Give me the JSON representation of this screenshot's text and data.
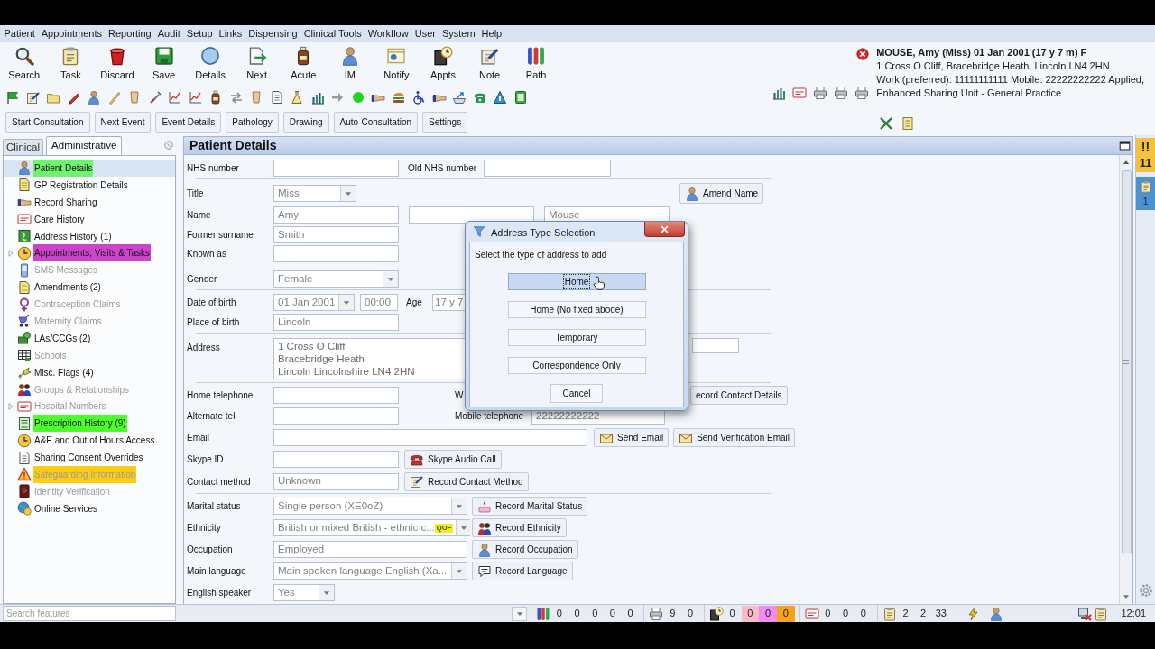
{
  "menu": [
    "Patient",
    "Appointments",
    "Reporting",
    "Audit",
    "Setup",
    "Links",
    "Dispensing",
    "Clinical Tools",
    "Workflow",
    "User",
    "System",
    "Help"
  ],
  "toolbar": [
    "Search",
    "Task",
    "Discard",
    "Save",
    "Details",
    "Next",
    "Acute",
    "IM",
    "Notify",
    "Appts",
    "Note",
    "Path"
  ],
  "consultation_buttons": [
    "Start Consultation",
    "Next Event",
    "Event Details",
    "Pathology",
    "Drawing",
    "Auto-Consultation",
    "Settings"
  ],
  "patient_banner": {
    "name": "MOUSE, Amy (Miss) 01 Jan 2001 (17 y 7 m) F",
    "lines": [
      "1 Cross O Cliff, Bracebridge Heath, Lincoln LN4 2HN",
      "Work (preferred): 11111111111 Mobile: 22222222222 Applied,",
      "Enhanced Sharing Unit - General Practice"
    ]
  },
  "sidebar": {
    "tabs": [
      {
        "label": "Clinical",
        "selected": false
      },
      {
        "label": "Administrative",
        "selected": true
      }
    ],
    "items": [
      {
        "label": "Patient Details",
        "selected": true,
        "disabled": false,
        "expandable": false,
        "color": "#6ef56e"
      },
      {
        "label": "GP Registration Details",
        "selected": false,
        "disabled": false,
        "expandable": false
      },
      {
        "label": "Record Sharing",
        "selected": false,
        "disabled": false,
        "expandable": false
      },
      {
        "label": "Care History",
        "selected": false,
        "disabled": false,
        "expandable": false
      },
      {
        "label": "Address History (1)",
        "selected": false,
        "disabled": false,
        "expandable": false
      },
      {
        "label": "Appointments, Visits & Tasks",
        "selected": false,
        "disabled": false,
        "expandable": true,
        "color": "#cc44cc"
      },
      {
        "label": "SMS Messages",
        "selected": false,
        "disabled": true,
        "expandable": false
      },
      {
        "label": "Amendments (2)",
        "selected": false,
        "disabled": false,
        "expandable": false
      },
      {
        "label": "Contraception Claims",
        "selected": false,
        "disabled": true,
        "expandable": false
      },
      {
        "label": "Maternity Claims",
        "selected": false,
        "disabled": true,
        "expandable": false
      },
      {
        "label": "LAs/CCGs (2)",
        "selected": false,
        "disabled": false,
        "expandable": false
      },
      {
        "label": "Schools",
        "selected": false,
        "disabled": true,
        "expandable": false
      },
      {
        "label": "Misc. Flags (4)",
        "selected": false,
        "disabled": false,
        "expandable": false
      },
      {
        "label": "Groups & Relationships",
        "selected": false,
        "disabled": true,
        "expandable": false
      },
      {
        "label": "Hospital Numbers",
        "selected": false,
        "disabled": true,
        "expandable": true
      },
      {
        "label": "Prescription History (9)",
        "selected": false,
        "disabled": false,
        "expandable": false,
        "color": "#4cff2a"
      },
      {
        "label": "A&E and Out of Hours Access",
        "selected": false,
        "disabled": false,
        "expandable": false
      },
      {
        "label": "Sharing Consent Overrides",
        "selected": false,
        "disabled": false,
        "expandable": false
      },
      {
        "label": "Safeguarding Information",
        "selected": false,
        "disabled": true,
        "expandable": false,
        "color": "#ffcc11"
      },
      {
        "label": "Identity Verification",
        "selected": false,
        "disabled": true,
        "expandable": false
      },
      {
        "label": "Online Services",
        "selected": false,
        "disabled": false,
        "expandable": false
      }
    ]
  },
  "patient_details": {
    "title": "Patient Details",
    "rows": [
      {
        "label": "NHS number",
        "controls": [
          {
            "kind": "field"
          },
          {
            "kind": "label",
            "text": "Old NHS number"
          },
          {
            "kind": "field"
          }
        ]
      },
      {
        "label": "Title",
        "controls": [
          {
            "kind": "combo",
            "value": "Miss"
          },
          {
            "kind": "button",
            "text": "Amend Name"
          }
        ]
      },
      {
        "label": "Name",
        "controls": [
          {
            "kind": "field",
            "value": "Amy"
          },
          {
            "kind": "field"
          },
          {
            "kind": "field",
            "value": "Mouse"
          }
        ]
      },
      {
        "label": "Former surname",
        "controls": [
          {
            "kind": "field",
            "value": "Smith"
          }
        ]
      },
      {
        "label": "Known as",
        "controls": [
          {
            "kind": "field"
          }
        ]
      },
      {
        "label": "Gender",
        "controls": [
          {
            "kind": "combo",
            "value": "Female"
          }
        ]
      },
      {
        "label": "Date of birth",
        "controls": [
          {
            "kind": "combo",
            "value": "01 Jan 2001"
          },
          {
            "kind": "field",
            "value": "00:00"
          },
          {
            "kind": "label",
            "text": "Age"
          },
          {
            "kind": "field",
            "value": "17 y 7"
          }
        ]
      },
      {
        "label": "Place of birth",
        "controls": [
          {
            "kind": "field",
            "value": "Lincoln"
          }
        ]
      },
      {
        "label": "Address",
        "controls": [
          {
            "kind": "textarea",
            "lines": [
              "1 Cross O Cliff",
              "Bracebridge Heath",
              "Lincoln Lincolnshire LN4 2HN"
            ]
          },
          {
            "kind": "field"
          }
        ]
      },
      {
        "label": "Home telephone",
        "controls": [
          {
            "kind": "field"
          },
          {
            "kind": "label",
            "text": "W"
          },
          {
            "kind": "button",
            "text": "ecord Contact Details"
          }
        ]
      },
      {
        "label": "Alternate tel.",
        "controls": [
          {
            "kind": "field"
          },
          {
            "kind": "label",
            "text": "Mobile telephone"
          },
          {
            "kind": "field",
            "value": "22222222222"
          }
        ]
      },
      {
        "label": "Email",
        "controls": [
          {
            "kind": "field"
          },
          {
            "kind": "button",
            "text": "Send Email"
          },
          {
            "kind": "button",
            "text": "Send Verification Email"
          }
        ]
      },
      {
        "label": "Skype ID",
        "controls": [
          {
            "kind": "field"
          },
          {
            "kind": "button",
            "text": "Skype Audio Call"
          }
        ]
      },
      {
        "label": "Contact method",
        "controls": [
          {
            "kind": "field",
            "value": "Unknown"
          },
          {
            "kind": "button",
            "text": "Record Contact Method"
          }
        ]
      },
      {
        "label": "Marital status",
        "controls": [
          {
            "kind": "combo",
            "value": "Single person (XE0oZ)"
          },
          {
            "kind": "button",
            "text": "Record Marital Status"
          }
        ]
      },
      {
        "label": "Ethnicity",
        "controls": [
          {
            "kind": "combo",
            "value": "British or mixed British - ethnic c...",
            "badge": "QOF"
          },
          {
            "kind": "button",
            "text": "Record Ethnicity"
          }
        ]
      },
      {
        "label": "Occupation",
        "controls": [
          {
            "kind": "field",
            "value": "Employed"
          },
          {
            "kind": "button",
            "text": "Record Occupation"
          }
        ]
      },
      {
        "label": "Main language",
        "controls": [
          {
            "kind": "combo",
            "value": "Main spoken language English (Xa..."
          },
          {
            "kind": "button",
            "text": "Record Language"
          }
        ]
      },
      {
        "label": "English speaker",
        "controls": [
          {
            "kind": "combo",
            "value": "Yes"
          }
        ]
      }
    ]
  },
  "dialog": {
    "title": "Address Type Selection",
    "prompt": "Select the type of address to add",
    "options": [
      {
        "label": "Home",
        "selected": true
      },
      {
        "label": "Home (No fixed abode)",
        "selected": false
      },
      {
        "label": "Temporary",
        "selected": false
      },
      {
        "label": "Correspondence Only",
        "selected": false
      }
    ],
    "cancel": "Cancel"
  },
  "alerts": {
    "marks": "!!",
    "count": "11"
  },
  "tasks": {
    "count": "1"
  },
  "status_bar": {
    "search": {
      "placeholder": "Search features"
    },
    "groups": [
      {
        "values": [
          {
            "text": "0"
          },
          {
            "text": "0"
          },
          {
            "text": "0"
          },
          {
            "text": "0"
          },
          {
            "text": "0"
          }
        ]
      },
      {
        "values": [
          {
            "text": "9"
          },
          {
            "text": "0"
          }
        ]
      },
      {
        "values": [
          {
            "text": "0"
          },
          {
            "text": "0",
            "color": "#f8bcc8"
          },
          {
            "text": "0",
            "color": "#f08cf0"
          },
          {
            "text": "0",
            "color": "#f7a21b"
          }
        ]
      },
      {
        "values": [
          {
            "text": "0"
          },
          {
            "text": "0"
          },
          {
            "text": "0"
          }
        ]
      },
      {
        "values": [
          {
            "text": "2"
          },
          {
            "text": "2"
          },
          {
            "text": "33"
          }
        ]
      }
    ],
    "time": "12:01"
  }
}
